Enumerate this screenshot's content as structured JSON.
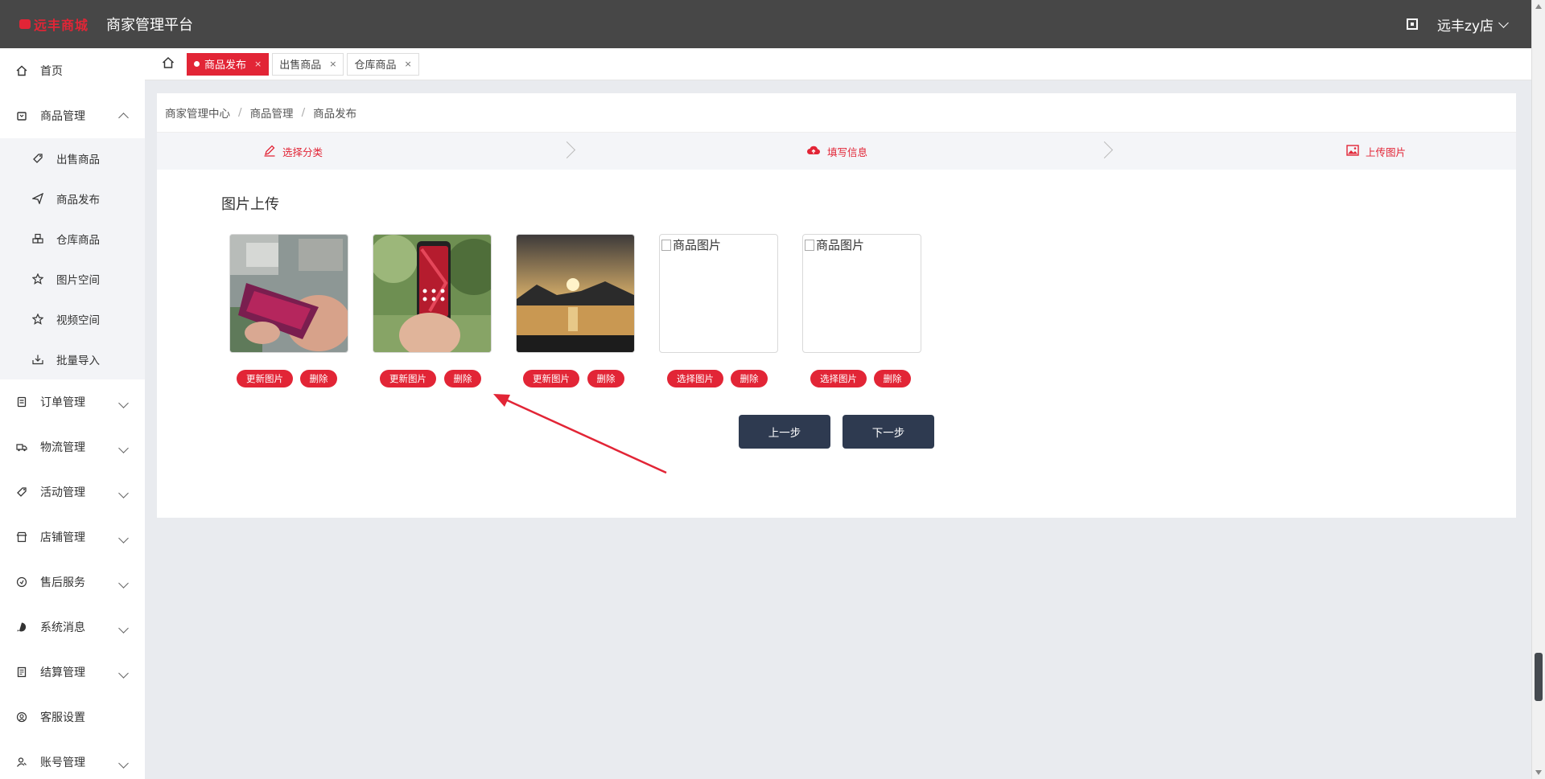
{
  "header": {
    "logo_text": "远丰商城",
    "platform_title": "商家管理平台",
    "store_name": "远丰zy店"
  },
  "sidebar": {
    "items": [
      {
        "label": "首页",
        "icon": "home-icon"
      },
      {
        "label": "商品管理",
        "icon": "goods-icon",
        "expanded": true,
        "children": [
          {
            "label": "出售商品",
            "icon": "tag-icon"
          },
          {
            "label": "商品发布",
            "icon": "send-icon"
          },
          {
            "label": "仓库商品",
            "icon": "warehouse-icon"
          },
          {
            "label": "图片空间",
            "icon": "star-icon"
          },
          {
            "label": "视频空间",
            "icon": "star-icon"
          },
          {
            "label": "批量导入",
            "icon": "import-icon"
          }
        ]
      },
      {
        "label": "订单管理",
        "icon": "order-icon"
      },
      {
        "label": "物流管理",
        "icon": "truck-icon"
      },
      {
        "label": "活动管理",
        "icon": "activity-icon"
      },
      {
        "label": "店铺管理",
        "icon": "shop-icon"
      },
      {
        "label": "售后服务",
        "icon": "service-icon"
      },
      {
        "label": "系统消息",
        "icon": "message-icon"
      },
      {
        "label": "结算管理",
        "icon": "settle-icon"
      },
      {
        "label": "客服设置",
        "icon": "support-icon"
      },
      {
        "label": "账号管理",
        "icon": "account-icon"
      }
    ]
  },
  "tabs": [
    {
      "label": "商品发布",
      "active": true,
      "close": "×"
    },
    {
      "label": "出售商品",
      "active": false,
      "close": "×"
    },
    {
      "label": "仓库商品",
      "active": false,
      "close": "×"
    }
  ],
  "breadcrumb": [
    "商家管理中心",
    "商品管理",
    "商品发布"
  ],
  "breadcrumb_sep": "/",
  "steps": [
    {
      "label": "选择分类",
      "icon": "edit-icon"
    },
    {
      "label": "填写信息",
      "icon": "cloud-upload-icon"
    },
    {
      "label": "上传图片",
      "icon": "image-icon"
    }
  ],
  "upload": {
    "title": "图片上传",
    "images": [
      {
        "type": "photo",
        "scene": "hand-phone-red-back",
        "primary": "更新图片",
        "delete": "删除"
      },
      {
        "type": "photo",
        "scene": "hand-phone-screen",
        "primary": "更新图片",
        "delete": "删除"
      },
      {
        "type": "photo",
        "scene": "sunset-lake",
        "primary": "更新图片",
        "delete": "删除"
      },
      {
        "type": "placeholder",
        "alt": "商品图片",
        "primary": "选择图片",
        "delete": "删除"
      },
      {
        "type": "placeholder",
        "alt": "商品图片",
        "primary": "选择图片",
        "delete": "删除"
      }
    ]
  },
  "nav": {
    "prev": "上一步",
    "next": "下一步"
  },
  "colors": {
    "accent": "#e22536",
    "header_bg": "#474747",
    "nav_btn": "#2e3a50"
  }
}
